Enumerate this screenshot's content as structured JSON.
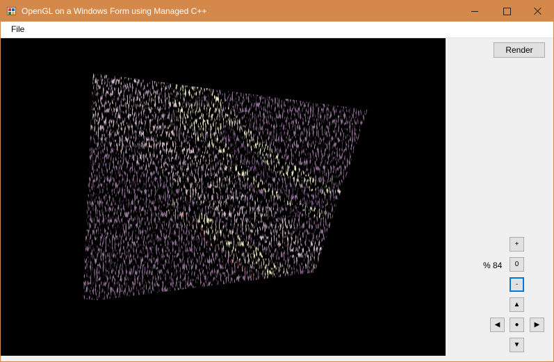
{
  "window": {
    "title": "OpenGL on a Windows Form using Managed C++",
    "accent_color": "#d4884a"
  },
  "menu": {
    "file": "File"
  },
  "render_panel": {
    "background": "#000000",
    "texture_colors": [
      "#8c6a8f",
      "#e6e6c2",
      "#6e4f78",
      "#c48a99"
    ]
  },
  "controls": {
    "render": "Render",
    "zoom_in": "+",
    "zoom_reset": "0",
    "zoom_out": "-",
    "zoom_percent": "% 84",
    "pan_up": "▲",
    "pan_left": "◀",
    "pan_center": "●",
    "pan_right": "▶",
    "pan_down": "▼"
  },
  "icons": {
    "app": "app-icon",
    "minimize": "minimize-icon",
    "maximize": "maximize-icon",
    "close": "close-icon"
  }
}
